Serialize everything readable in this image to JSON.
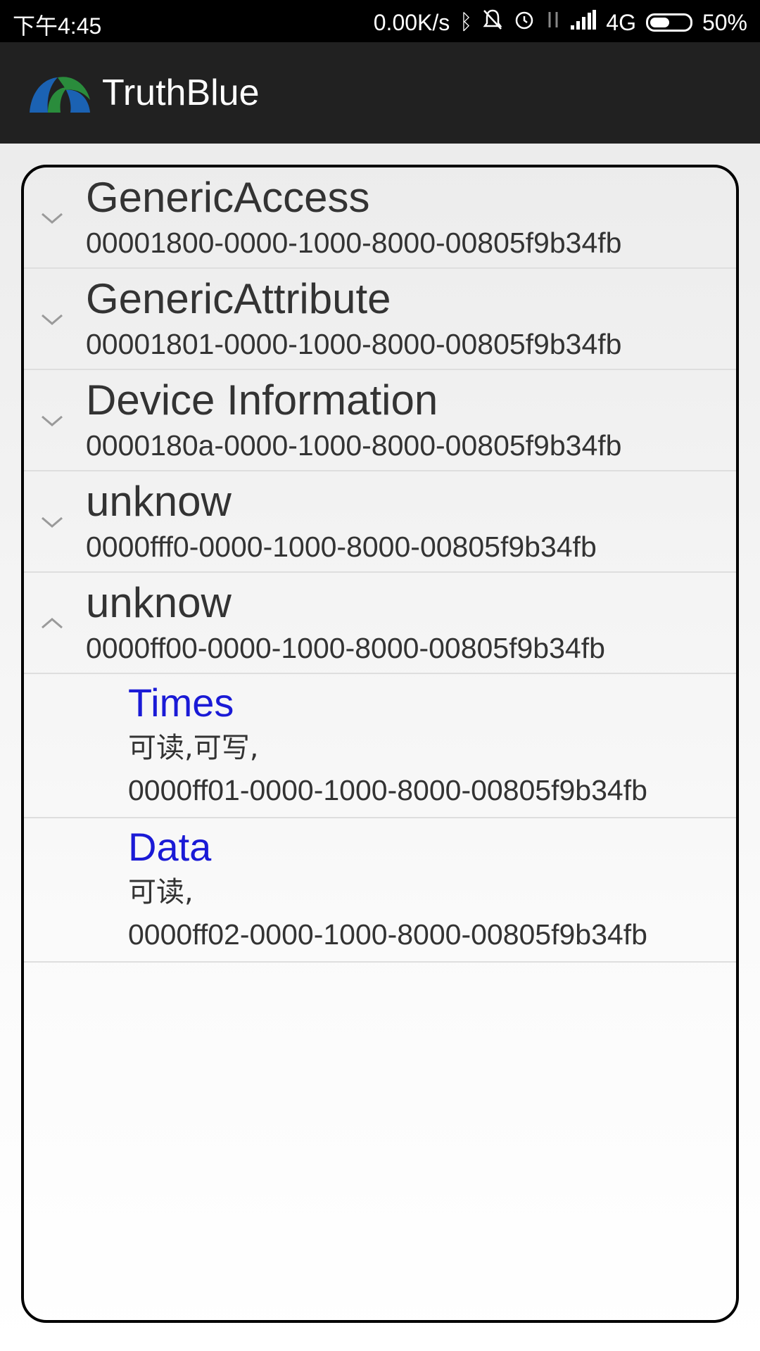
{
  "status_bar": {
    "time": "下午4:45",
    "network_speed": "0.00K/s",
    "signal_type": "4G",
    "battery_percent": "50%",
    "battery_level": 0.5
  },
  "app_bar": {
    "title": "TruthBlue"
  },
  "services": [
    {
      "name": "GenericAccess",
      "uuid": "00001800-0000-1000-8000-00805f9b34fb",
      "expanded": false
    },
    {
      "name": "GenericAttribute",
      "uuid": "00001801-0000-1000-8000-00805f9b34fb",
      "expanded": false
    },
    {
      "name": "Device Information",
      "uuid": "0000180a-0000-1000-8000-00805f9b34fb",
      "expanded": false
    },
    {
      "name": "unknow",
      "uuid": "0000fff0-0000-1000-8000-00805f9b34fb",
      "expanded": false
    },
    {
      "name": "unknow",
      "uuid": "0000ff00-0000-1000-8000-00805f9b34fb",
      "expanded": true
    }
  ],
  "characteristics": [
    {
      "name": "Times",
      "properties": "可读,可写,",
      "uuid": "0000ff01-0000-1000-8000-00805f9b34fb"
    },
    {
      "name": "Data",
      "properties": "可读,",
      "uuid": "0000ff02-0000-1000-8000-00805f9b34fb"
    }
  ],
  "colors": {
    "characteristic_name": "#1a1ad6",
    "app_bar": "#212121",
    "status_bar": "#000000"
  }
}
